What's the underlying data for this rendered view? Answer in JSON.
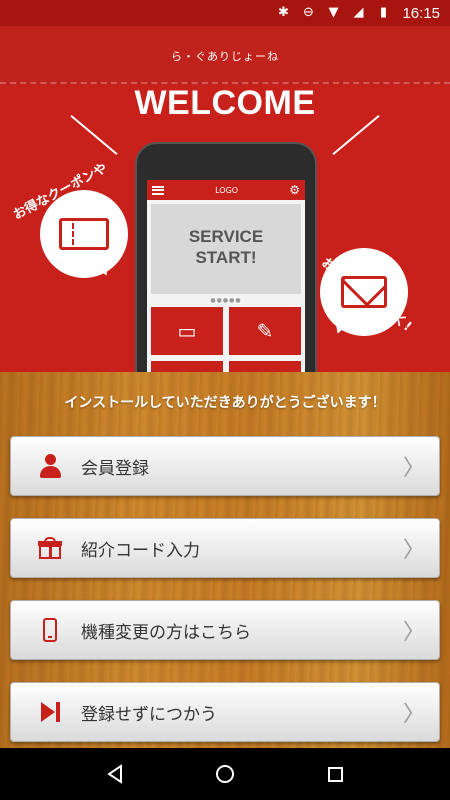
{
  "status_bar": {
    "time": "16:15",
    "icons": [
      "bluetooth-icon",
      "do-not-disturb-icon",
      "wifi-icon",
      "signal-icon",
      "battery-icon"
    ]
  },
  "hero": {
    "app_name": "ら・ぐありじょーね",
    "welcome": "WELCOME",
    "bubble_left_text": "お得なクーポンや",
    "bubble_right_text": "お店の情報が届く!",
    "phone": {
      "logo": "LOGO",
      "banner_line1": "SERVICE",
      "banner_line2": "START!",
      "dots": "●●●●●"
    }
  },
  "main": {
    "thanks": "インストールしていただきありがとうございます！",
    "buttons": [
      {
        "label": "会員登録",
        "icon": "person-icon"
      },
      {
        "label": "紹介コード入力",
        "icon": "gift-icon"
      },
      {
        "label": "機種変更の方はこちら",
        "icon": "smartphone-icon"
      },
      {
        "label": "登録せずにつかう",
        "icon": "skip-icon"
      }
    ]
  },
  "colors": {
    "brand_red": "#c8201a",
    "wood": "#c77e27",
    "button_text": "#333333"
  }
}
